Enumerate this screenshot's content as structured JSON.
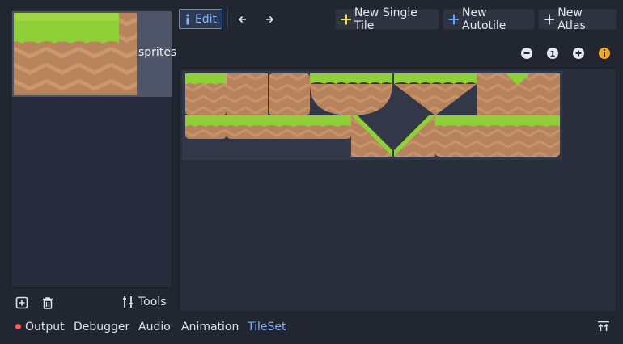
{
  "texture_list": {
    "items": [
      {
        "label": "sprites"
      }
    ]
  },
  "left_tools": {
    "tools_label": "Tools",
    "icons": [
      "add-texture-icon",
      "trash-icon",
      "tools-icon"
    ]
  },
  "toolbar": {
    "edit_label": "Edit",
    "new_single_tile_label": "New Single Tile",
    "new_autotile_label": "New Autotile",
    "new_atlas_label": "New Atlas",
    "icons": [
      "pencil-icon",
      "arrow-left-icon",
      "arrow-right-icon",
      "plus-icon"
    ]
  },
  "zoom": {
    "icons": [
      "zoom-out-icon",
      "zoom-reset-icon",
      "zoom-in-icon",
      "info-icon"
    ],
    "reset_label": "1"
  },
  "bottom_tabs": {
    "output": "Output",
    "debugger": "Debugger",
    "audio": "Audio",
    "animation": "Animation",
    "tileset": "TileSet",
    "active": "TileSet"
  },
  "colors": {
    "accent": "#7fb0f5",
    "info_orange": "#f5a623",
    "plus_yellow": "#f2e14c",
    "plus_blue": "#6aa6ff",
    "grass": "#8fcf37",
    "dirt": "#b7835c"
  }
}
